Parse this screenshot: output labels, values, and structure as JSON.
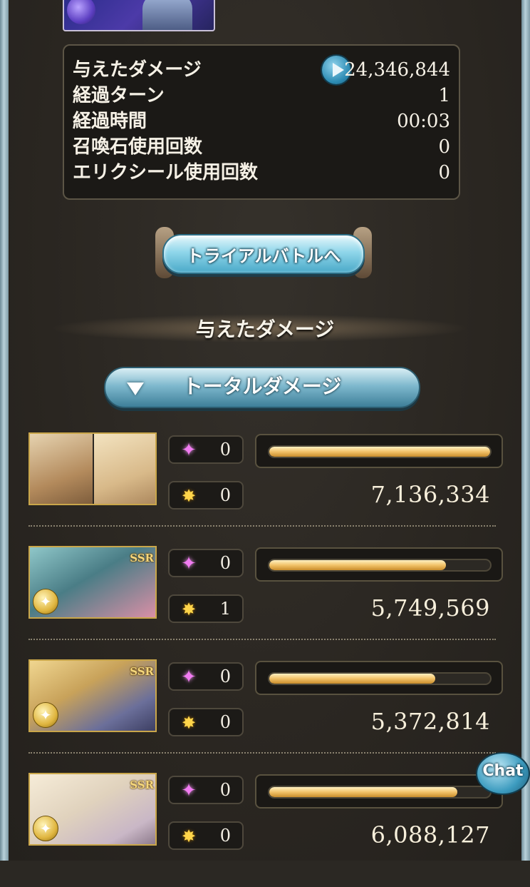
{
  "stats": [
    {
      "label": "与えたダメージ",
      "value": "24,346,844"
    },
    {
      "label": "経過ターン",
      "value": "1"
    },
    {
      "label": "経過時間",
      "value": "00:03"
    },
    {
      "label": "召喚石使用回数",
      "value": "0"
    },
    {
      "label": "エリクシール使用回数",
      "value": "0"
    }
  ],
  "trial_button_label": "トライアルバトルへ",
  "section_title": "与えたダメージ",
  "total_damage_label": "トータルダメージ",
  "chat_label": "Chat",
  "colors": {
    "accent": "#4aa9c8",
    "bar_fill": "#f2c269",
    "gold": "#c9a64a"
  },
  "characters": [
    {
      "ssr": "",
      "special_count": "0",
      "ability_count": "0",
      "damage": "7,136,334",
      "bar_fraction": 1.0,
      "art": [
        "#c9a87a",
        "#e8d3a8"
      ]
    },
    {
      "ssr": "SSR",
      "special_count": "0",
      "ability_count": "1",
      "damage": "5,749,569",
      "bar_fraction": 0.8,
      "art": [
        "#4a7d86",
        "#d98fa6"
      ]
    },
    {
      "ssr": "SSR",
      "special_count": "0",
      "ability_count": "0",
      "damage": "5,372,814",
      "bar_fraction": 0.75,
      "art": [
        "#c8a25a",
        "#6b6f9a"
      ]
    },
    {
      "ssr": "SSR",
      "special_count": "0",
      "ability_count": "0",
      "damage": "6,088,127",
      "bar_fraction": 0.85,
      "art": [
        "#e0d2bd",
        "#c9b7c6"
      ]
    }
  ]
}
